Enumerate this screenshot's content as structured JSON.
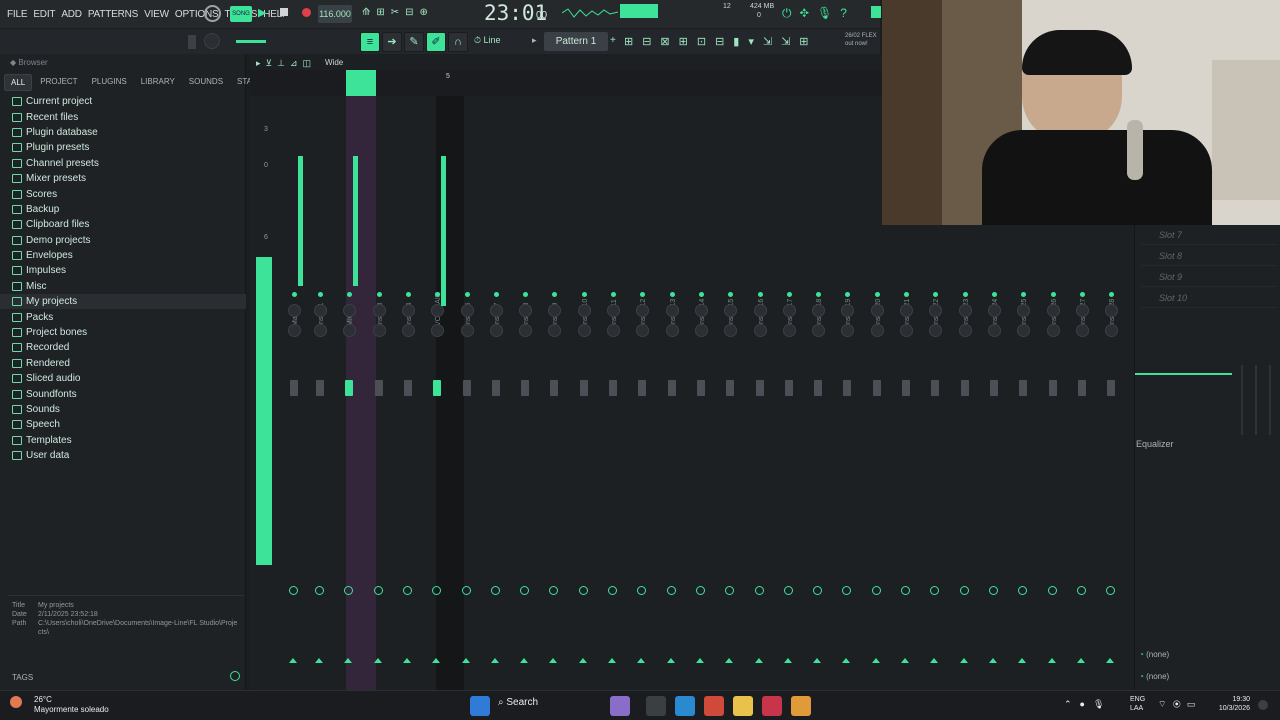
{
  "menu": {
    "items": [
      "FILE",
      "EDIT",
      "ADD",
      "PATTERNS",
      "VIEW",
      "OPTIONS",
      "TOOLS",
      "HELP"
    ],
    "tempo": "116.000",
    "time": "23:01",
    "time_sub": "00",
    "memory": "424 MB",
    "cpu_count": "12",
    "poly": "0",
    "song_mode": "SONG",
    "news_line1": "26/02 FLEX",
    "news_line2": "out now!"
  },
  "toolbar2": {
    "snap": "Line",
    "pattern": "Pattern 1"
  },
  "browser": {
    "title": "Browser",
    "tabs": [
      "ALL",
      "PROJECT",
      "PLUGINS",
      "LIBRARY",
      "SOUNDS",
      "STARRED"
    ],
    "items": [
      "Current project",
      "Recent files",
      "Plugin database",
      "Plugin presets",
      "Channel presets",
      "Mixer presets",
      "Scores",
      "Backup",
      "Clipboard files",
      "Demo projects",
      "Envelopes",
      "Impulses",
      "Misc",
      "My projects",
      "Packs",
      "Project bones",
      "Recorded",
      "Rendered",
      "Sliced audio",
      "Soundfonts",
      "Sounds",
      "Speech",
      "Templates",
      "User data"
    ],
    "info": {
      "title_label": "Title",
      "title_value": "My projects",
      "date_label": "Date",
      "date_value": "2/11/2025 23:52:18",
      "path_label": "Path",
      "path_value": "C:\\Users\\choli\\OneDrive\\Documents\\Image-Line\\FL Studio\\Projects\\"
    },
    "tags_label": "TAGS"
  },
  "mixer": {
    "view_label": "Wide",
    "scale": [
      "3",
      "0",
      "6"
    ],
    "strips": [
      "Master",
      "Insert 1",
      "MIC",
      "Insert 3",
      "Insert 4",
      "VOZ MAIN",
      "Insert 6",
      "Insert 7",
      "Insert 8",
      "Insert 9",
      "Insert 10",
      "Insert 11",
      "Insert 12",
      "Insert 13",
      "Insert 14",
      "Insert 15",
      "Insert 16",
      "Insert 17",
      "Insert 18",
      "Insert 19",
      "Insert 20",
      "Insert 21",
      "Insert 22",
      "Insert 23",
      "Insert 24",
      "Insert 25",
      "Insert 26",
      "Insert 27",
      "Insert 28"
    ],
    "header_number": "5"
  },
  "fx": {
    "slots": [
      "Slot 7",
      "Slot 8",
      "Slot 9",
      "Slot 10"
    ],
    "eq_label": "Equalizer",
    "out1": "(none)",
    "out2": "(none)"
  },
  "taskbar": {
    "weather_temp": "26°C",
    "weather_desc": "Mayormente soleado",
    "search": "Search",
    "lang1": "ENG",
    "lang2": "LAA",
    "clock_time": "19:30",
    "clock_date": "10/3/2026"
  },
  "colors": {
    "accent": "#3ee39a",
    "bg": "#1d2023",
    "mic_strip": "#3a2a3a"
  }
}
